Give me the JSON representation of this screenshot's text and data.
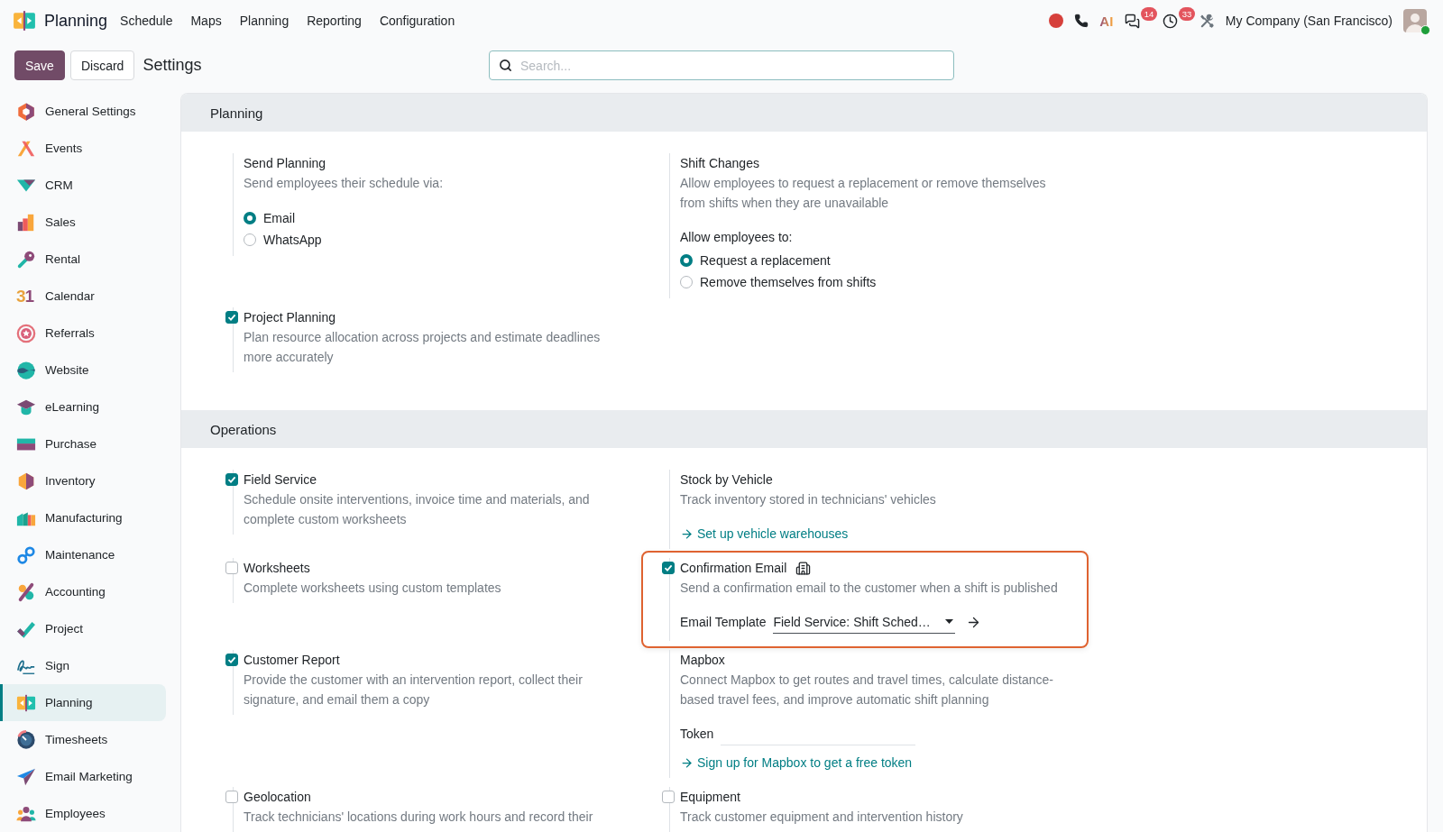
{
  "navbar": {
    "app_name": "Planning",
    "menu": [
      "Schedule",
      "Maps",
      "Planning",
      "Reporting",
      "Configuration"
    ],
    "ai_label": "AI",
    "messages_badge": "14",
    "activities_badge": "33",
    "company": "My Company (San Francisco)",
    "user_online": true
  },
  "control_panel": {
    "buttons": [
      {
        "kind": "primary",
        "label": "Save"
      },
      {
        "kind": "secondary",
        "label": "Discard"
      }
    ],
    "title": "Settings",
    "search": {
      "placeholder": "Search..."
    }
  },
  "sidebar": {
    "items": [
      {
        "label": "General Settings",
        "selected": false
      },
      {
        "label": "Events",
        "selected": false
      },
      {
        "label": "CRM",
        "selected": false
      },
      {
        "label": "Sales",
        "selected": false
      },
      {
        "label": "Rental",
        "selected": false
      },
      {
        "label": "Calendar",
        "selected": false,
        "icon_text": "31"
      },
      {
        "label": "Referrals",
        "selected": false
      },
      {
        "label": "Website",
        "selected": false
      },
      {
        "label": "eLearning",
        "selected": false
      },
      {
        "label": "Purchase",
        "selected": false
      },
      {
        "label": "Inventory",
        "selected": false
      },
      {
        "label": "Manufacturing",
        "selected": false
      },
      {
        "label": "Maintenance",
        "selected": false
      },
      {
        "label": "Accounting",
        "selected": false
      },
      {
        "label": "Project",
        "selected": false
      },
      {
        "label": "Sign",
        "selected": false
      },
      {
        "label": "Planning",
        "selected": true
      },
      {
        "label": "Timesheets",
        "selected": false
      },
      {
        "label": "Email Marketing",
        "selected": false
      },
      {
        "label": "Employees",
        "selected": false
      }
    ]
  },
  "sections": [
    {
      "title": "Planning",
      "settings": [
        {
          "title": "Send Planning",
          "description": "Send employees their schedule via:",
          "highlighted": false,
          "company_specific": false,
          "options": {
            "choices": [
              {
                "label": "Email",
                "selected": true
              },
              {
                "label": "WhatsApp",
                "selected": false
              }
            ]
          }
        },
        {
          "title": "Shift Changes",
          "description": "Allow employees to request a replacement or remove themselves from shifts when they are unavailable",
          "highlighted": false,
          "company_specific": false,
          "options": {
            "label": "Allow employees to:",
            "choices": [
              {
                "label": "Request a replacement",
                "selected": true
              },
              {
                "label": "Remove themselves from shifts",
                "selected": false
              }
            ]
          }
        },
        {
          "title": "Project Planning",
          "checked": true,
          "description": "Plan resource allocation across projects and estimate deadlines more accurately",
          "highlighted": false,
          "company_specific": false
        }
      ]
    },
    {
      "title": "Operations",
      "settings": [
        {
          "title": "Field Service",
          "checked": true,
          "description": "Schedule onsite interventions, invoice time and materials, and complete custom worksheets",
          "highlighted": false,
          "company_specific": false
        },
        {
          "title": "Stock by Vehicle",
          "description": "Track inventory stored in technicians' vehicles",
          "link": "Set up vehicle warehouses",
          "highlighted": false,
          "company_specific": false
        },
        {
          "title": "Worksheets",
          "checked": false,
          "description": "Complete worksheets using custom templates",
          "highlighted": false,
          "company_specific": false
        },
        {
          "title": "Confirmation Email",
          "checked": true,
          "description": "Send a confirmation email to the customer when a shift is published",
          "highlighted": true,
          "company_specific": true,
          "field": {
            "kind": "select",
            "label": "Email Template",
            "value": "Field Service: Shift Sched…"
          }
        },
        {
          "title": "Customer Report",
          "checked": true,
          "description": "Provide the customer with an intervention report, collect their signature, and email them a copy",
          "highlighted": false,
          "company_specific": false
        },
        {
          "title": "Mapbox",
          "description": "Connect Mapbox to get routes and travel times, calculate distance-based travel fees, and improve automatic shift planning",
          "field": {
            "kind": "text",
            "label": "Token"
          },
          "link": "Sign up for Mapbox to get a free token",
          "highlighted": false,
          "company_specific": false
        },
        {
          "title": "Geolocation",
          "checked": false,
          "description": "Track technicians' locations during work hours and record their",
          "highlighted": false,
          "company_specific": false
        },
        {
          "title": "Equipment",
          "checked": false,
          "description": "Track customer equipment and intervention history",
          "highlighted": false,
          "company_specific": false
        }
      ]
    }
  ]
}
